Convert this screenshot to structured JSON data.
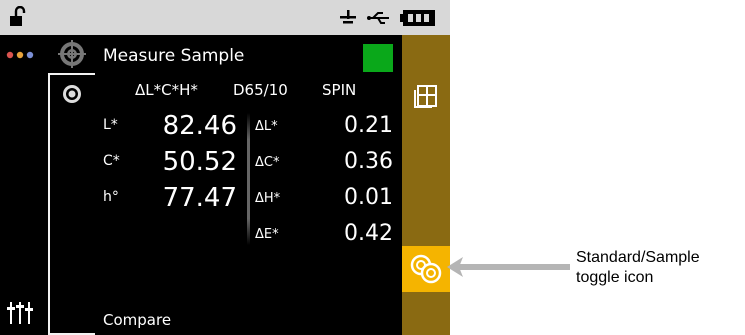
{
  "status_icons": [
    "lock-open-icon",
    "airplane-icon",
    "usb-icon",
    "battery-icon"
  ],
  "left_rail": {
    "icons": [
      "status-dots-icon",
      "settings-sliders-icon"
    ]
  },
  "inner_rail": {
    "icons": [
      "target-icon",
      "sample-icon"
    ]
  },
  "header": {
    "title": "Measure Sample",
    "sample_color": "#0aa81a",
    "color_space": "ΔL*C*H*",
    "illuminant": "D65/10",
    "mode": "SPIN"
  },
  "measurements": [
    {
      "label": "L*",
      "value": "82.46",
      "delta_label": "ΔL*",
      "delta_value": "0.21"
    },
    {
      "label": "C*",
      "value": "50.52",
      "delta_label": "ΔC*",
      "delta_value": "0.36"
    },
    {
      "label": "h°",
      "value": "77.47",
      "delta_label": "ΔH*",
      "delta_value": "0.01"
    },
    {
      "label": "",
      "value": "",
      "delta_label": "ΔE*",
      "delta_value": "0.42"
    }
  ],
  "footer": {
    "compare_label": "Compare"
  },
  "right_rail": {
    "icons": [
      "tolerance-grid-icon",
      "standard-sample-toggle-icon"
    ],
    "rail_color": "#8a6a12",
    "toggle_color": "#f5b400"
  },
  "callout": {
    "line1": "Standard/Sample",
    "line2": "toggle icon"
  }
}
